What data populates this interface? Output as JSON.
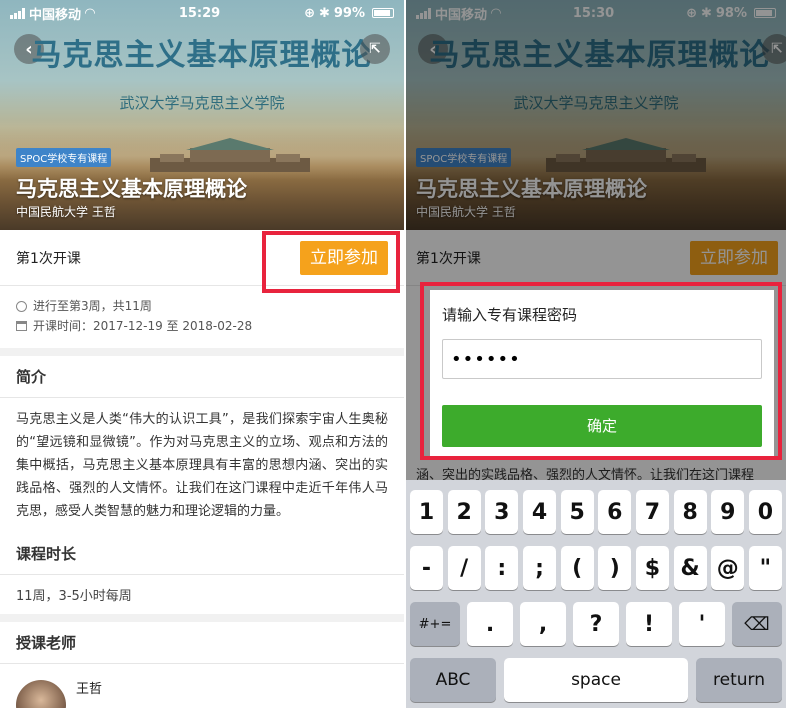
{
  "left_screen": {
    "status": {
      "carrier": "中国移动",
      "time": "15:29",
      "battery": "99%"
    },
    "hero": {
      "title": "马克思主义基本原理概论",
      "subtitle": "武汉大学马克思主义学院",
      "badge": "SPOC学校专有课程",
      "course_name": "马克思主义基本原理概论",
      "course_meta": "中国民航大学 王哲"
    },
    "session_label": "第1次开课",
    "join_label": "立即参加",
    "progress_text": "进行至第3周，共11周",
    "date_text": "开课时间：2017-12-19 至 2018-02-28",
    "intro_title": "简介",
    "intro_text": "马克思主义是人类“伟大的认识工具”，是我们探索宇宙人生奥秘的“望远镜和显微镜”。作为对马克思主义的立场、观点和方法的集中概括，马克思主义基本原理具有丰富的思想内涵、突出的实践品格、强烈的人文情怀。让我们在这门课程中走近千年伟人马克思，感受人类智慧的魅力和理论逻辑的力量。",
    "duration_title": "课程时长",
    "duration_text": "11周，3-5小时每周",
    "teacher_title": "授课老师",
    "teacher_name": "王哲"
  },
  "right_screen": {
    "status": {
      "carrier": "中国移动",
      "time": "15:30",
      "battery": "98%"
    },
    "hero": {
      "title": "马克思主义基本原理概论",
      "subtitle": "武汉大学马克思主义学院",
      "badge": "SPOC学校专有课程",
      "course_name": "马克思主义基本原理概论",
      "course_meta": "中国民航大学 王哲"
    },
    "session_label": "第1次开课",
    "join_label": "立即参加",
    "bg_text_line": "涵、突出的实践品格、强烈的人文情怀。让我们在这门课程",
    "dialog": {
      "title": "请输入专有课程密码",
      "password_value": "••••••",
      "confirm_label": "确定"
    },
    "keyboard": {
      "row1": [
        "1",
        "2",
        "3",
        "4",
        "5",
        "6",
        "7",
        "8",
        "9",
        "0"
      ],
      "row2": [
        "-",
        "/",
        ":",
        ";",
        "(",
        ")",
        "$",
        "&",
        "@",
        "\""
      ],
      "shift_label": "#+=",
      "row3": [
        ".",
        ",",
        "?",
        "!",
        "'"
      ],
      "abc_label": "ABC",
      "space_label": "space",
      "return_label": "return"
    }
  },
  "colors": {
    "join_button": "#f5a21c",
    "confirm_button": "#3dab2c",
    "highlight_frame": "#e8233d",
    "badge": "#3e84c9"
  }
}
